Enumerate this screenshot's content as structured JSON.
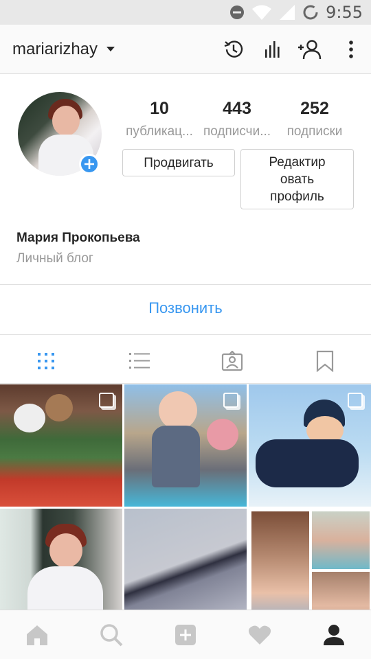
{
  "status_bar": {
    "time": "9:55"
  },
  "header": {
    "username": "mariarizhay"
  },
  "profile": {
    "stats": [
      {
        "value": "10",
        "label": "публикац..."
      },
      {
        "value": "443",
        "label": "подписчи..."
      },
      {
        "value": "252",
        "label": "подписки"
      }
    ],
    "promote_label": "Продвигать",
    "edit_label_line1": "Редактир",
    "edit_label_line2": "овать",
    "edit_label_line3": "профиль",
    "full_name": "Мария Прокопьева",
    "category": "Личный блог",
    "call_label": "Позвонить"
  },
  "colors": {
    "accent": "#3897f0",
    "text": "#262626",
    "muted": "#999999"
  },
  "tabs": [
    "grid-icon",
    "list-icon",
    "tagged-icon",
    "saved-icon"
  ],
  "bottom_nav": [
    "home-icon",
    "search-icon",
    "add-icon",
    "heart-icon",
    "profile-icon"
  ]
}
